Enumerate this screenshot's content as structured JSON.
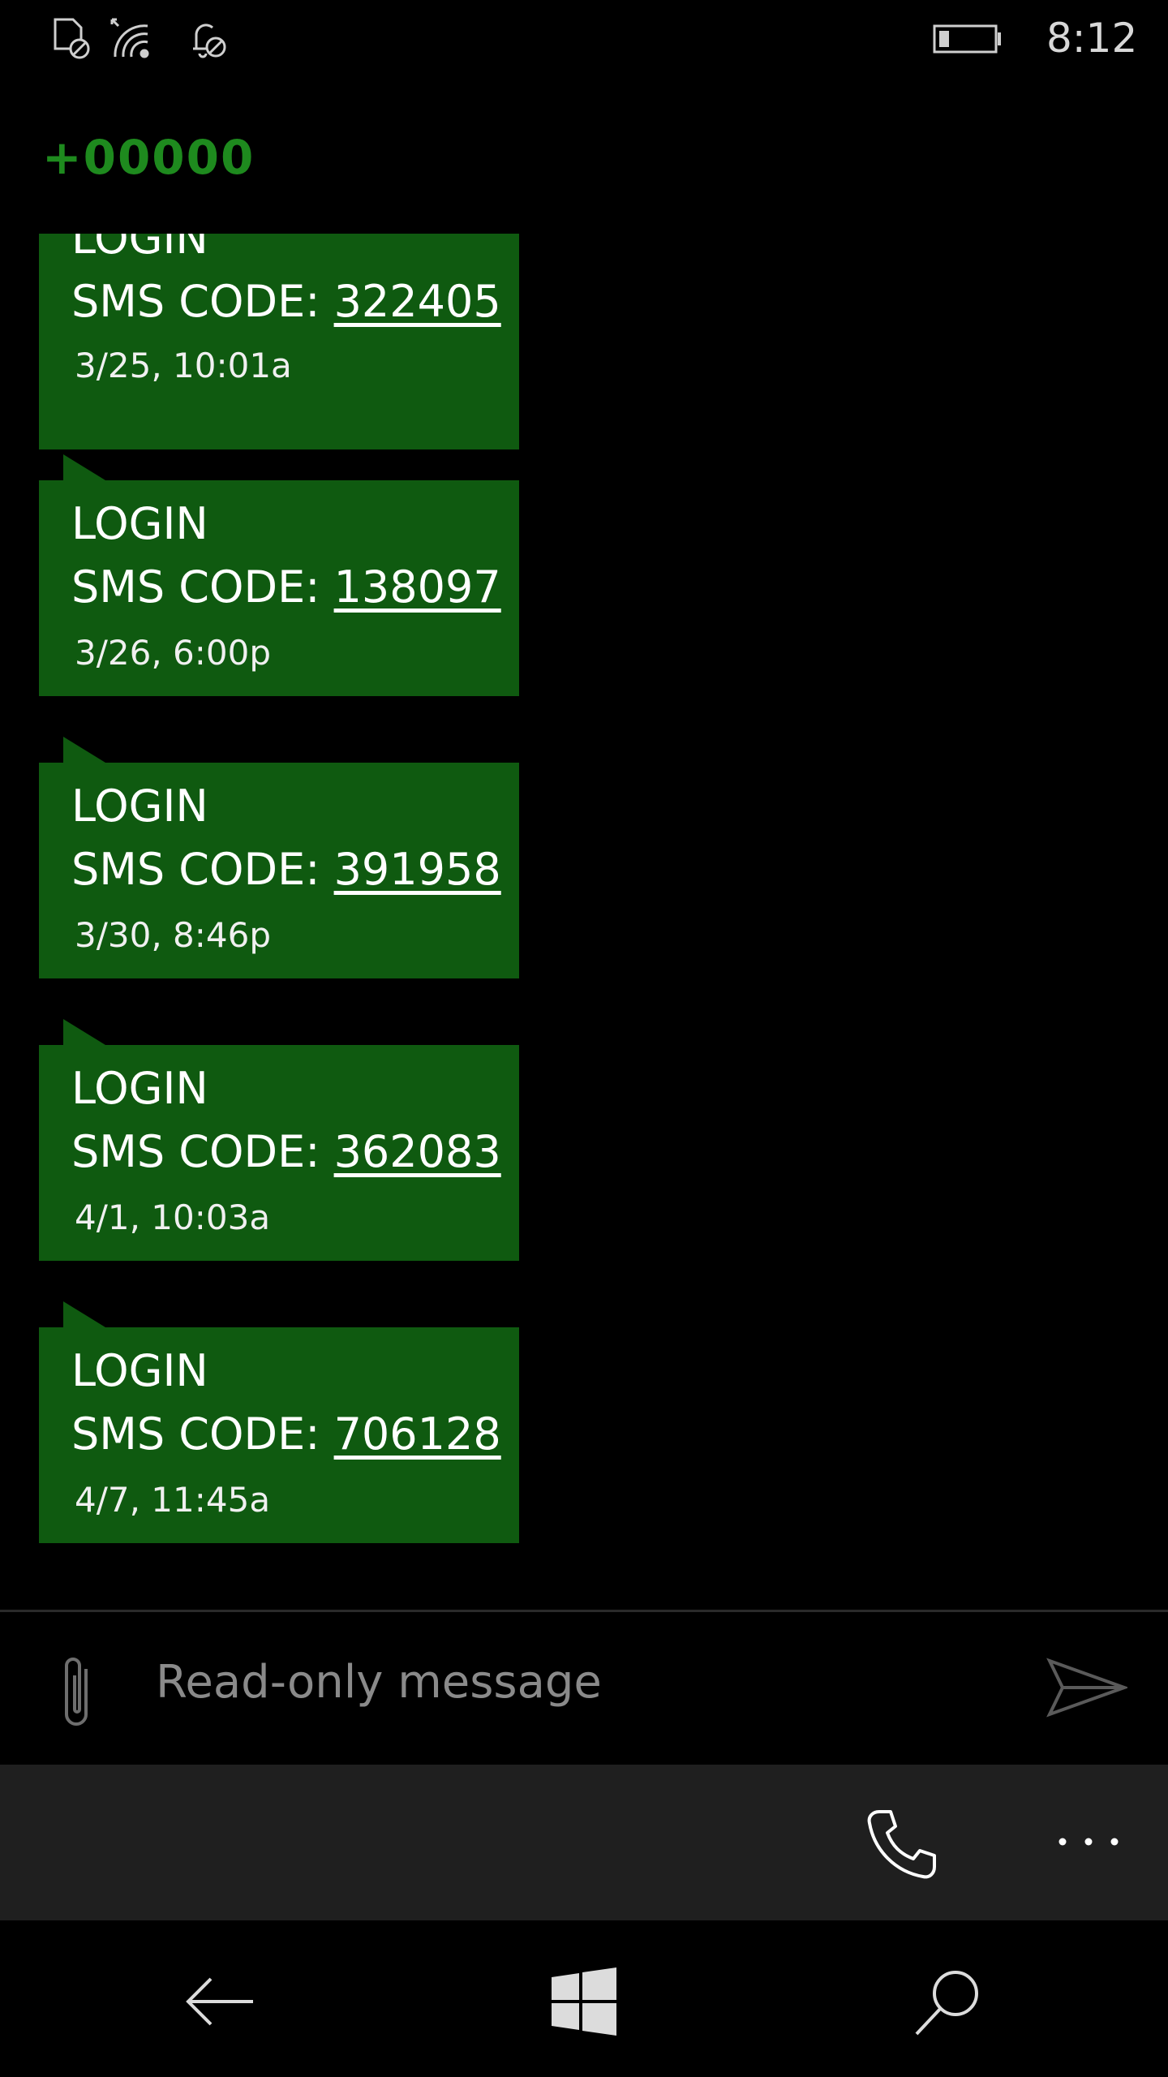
{
  "status_bar": {
    "time": "8:12",
    "icons": [
      "no-sim-icon",
      "wifi-icon",
      "notification-off-icon",
      "battery-low-icon"
    ]
  },
  "header": {
    "contact": "+00000"
  },
  "messages": [
    {
      "title": "LOGIN",
      "code_label": "SMS CODE: ",
      "code": "322405",
      "timestamp": "3/25, 10:01a"
    },
    {
      "title": "LOGIN",
      "code_label": "SMS CODE: ",
      "code": "138097",
      "timestamp": "3/26, 6:00p"
    },
    {
      "title": "LOGIN",
      "code_label": "SMS CODE: ",
      "code": "391958",
      "timestamp": "3/30, 8:46p"
    },
    {
      "title": "LOGIN",
      "code_label": "SMS CODE: ",
      "code": "362083",
      "timestamp": "4/1, 10:03a"
    },
    {
      "title": "LOGIN",
      "code_label": "SMS CODE: ",
      "code": "706128",
      "timestamp": "4/7, 11:45a"
    }
  ],
  "compose": {
    "placeholder": "Read-only message",
    "attach_icon": "paperclip-icon",
    "send_icon": "send-icon"
  },
  "app_bar": {
    "call_icon": "phone-icon",
    "more_icon": "more-icon"
  },
  "nav_bar": {
    "back_icon": "back-arrow-icon",
    "home_icon": "windows-logo-icon",
    "search_icon": "search-icon"
  },
  "colors": {
    "accent": "#1e8a1e",
    "bubble": "#0f5a10",
    "background": "#000000",
    "app_bar": "#1f1f1f"
  }
}
